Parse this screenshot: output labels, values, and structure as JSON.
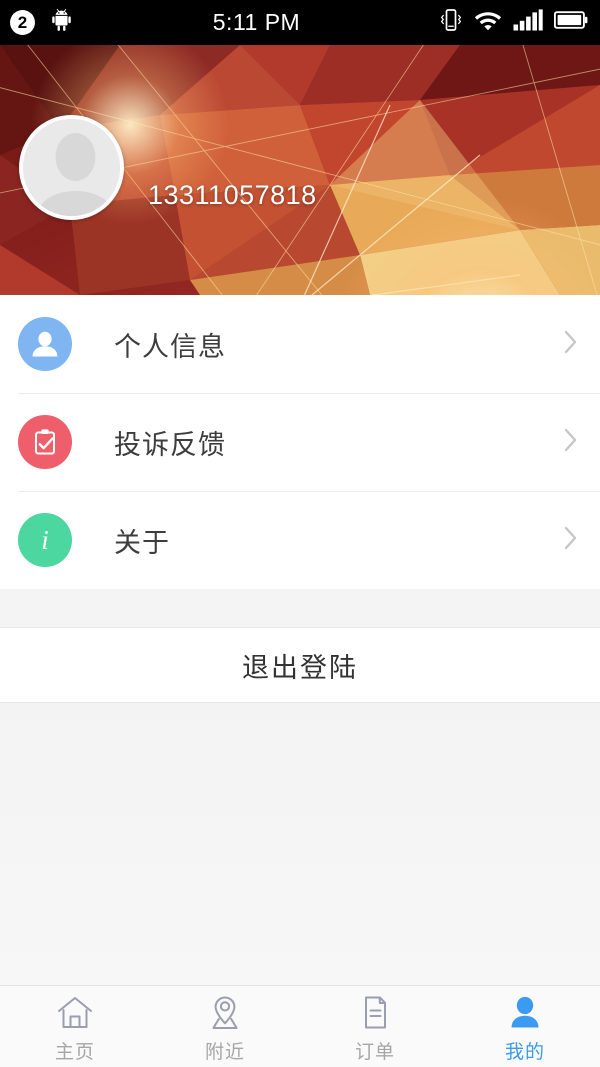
{
  "status_bar": {
    "notification_count": "2",
    "android_icon": "android-robot-icon",
    "time": "5:11 PM",
    "icons": [
      "vibrate-icon",
      "wifi-icon",
      "signal-icon",
      "battery-icon"
    ]
  },
  "header": {
    "avatar_icon": "default-avatar-icon",
    "phone_number": "13311057818",
    "background": "low-poly-red-gold"
  },
  "menu": {
    "items": [
      {
        "label": "个人信息",
        "icon": "person-icon",
        "color": "#7FB6F2",
        "chevron": "chevron-right-icon"
      },
      {
        "label": "投诉反馈",
        "icon": "clipboard-check-icon",
        "color": "#EE5F6B",
        "chevron": "chevron-right-icon"
      },
      {
        "label": "关于",
        "icon": "info-icon",
        "color": "#4CD6A0",
        "chevron": "chevron-right-icon"
      }
    ]
  },
  "logout": {
    "label": "退出登陆"
  },
  "tabbar": {
    "active_color": "#3B9BF0",
    "inactive_color": "#A6A6A6",
    "tabs": [
      {
        "label": "主页",
        "icon": "home-icon",
        "active": false
      },
      {
        "label": "附近",
        "icon": "location-pin-icon",
        "active": false
      },
      {
        "label": "订单",
        "icon": "document-icon",
        "active": false
      },
      {
        "label": "我的",
        "icon": "person-filled-icon",
        "active": true
      }
    ]
  }
}
